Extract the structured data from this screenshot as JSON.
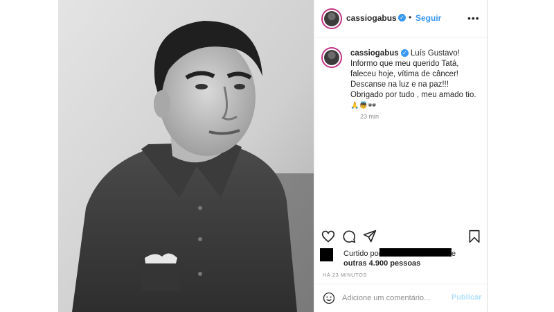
{
  "post": {
    "author": {
      "username": "cassiogabus",
      "verified_icon": "verified-badge-icon",
      "follow_label": "Seguir"
    },
    "caption": {
      "username": "cassiogabus",
      "text_line1": "Luís Gustavo! Informo que meu querido Tatá, faleceu hoje, vítima de câncer! Descanse na luz e na paz!!!",
      "text_line2": "Obrigado por tudo , meu amado tio.",
      "emojis": "🙏👼🕶",
      "time": "23 min"
    },
    "likes": {
      "prefix": "Curtido por",
      "suffix": "e",
      "others": "outras 4.900 pessoas"
    },
    "timestamp": "HÁ 23 MINUTOS",
    "comment": {
      "placeholder": "Adicione um comentário...",
      "publish_label": "Publicar"
    },
    "colors": {
      "link_blue": "#3897f0",
      "publish_disabled": "#b2dffc",
      "secondary_text": "#8e8e8e"
    }
  }
}
